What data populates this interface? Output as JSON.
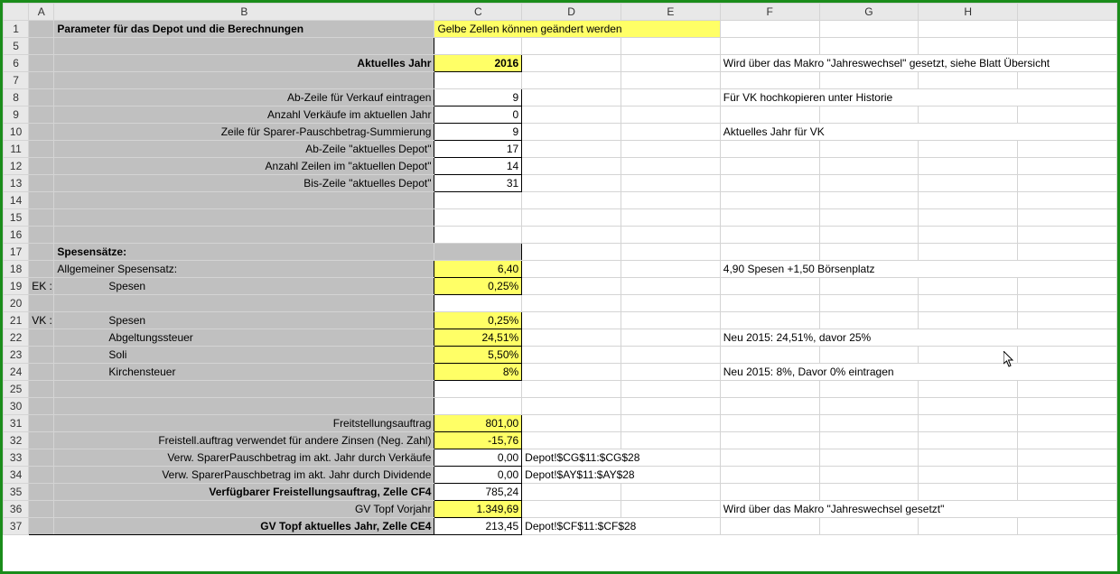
{
  "columns": [
    "A",
    "B",
    "C",
    "D",
    "E",
    "F",
    "G",
    "H"
  ],
  "r1": {
    "B": "Parameter für das Depot und die Berechnungen",
    "C": "Gelbe Zellen können geändert werden"
  },
  "r6": {
    "B": "Aktuelles Jahr",
    "C": "2016",
    "F": "Wird über das Makro \"Jahreswechsel\" gesetzt, siehe Blatt Übersicht"
  },
  "r8": {
    "B": "Ab-Zeile für Verkauf eintragen",
    "C": "9",
    "F": "Für VK hochkopieren unter Historie"
  },
  "r9": {
    "B": "Anzahl Verkäufe im aktuellen Jahr",
    "C": "0"
  },
  "r10": {
    "B": "Zeile für Sparer-Pauschbetrag-Summierung",
    "C": "9",
    "F": "Aktuelles Jahr für VK"
  },
  "r11": {
    "B": "Ab-Zeile \"aktuelles Depot\"",
    "C": "17"
  },
  "r12": {
    "B": "Anzahl Zeilen im \"aktuellen Depot\"",
    "C": "14"
  },
  "r13": {
    "B": "Bis-Zeile \"aktuelles Depot\"",
    "C": "31"
  },
  "r17": {
    "B": "Spesensätze:"
  },
  "r18": {
    "B": "Allgemeiner Spesensatz:",
    "C": "6,40",
    "F": "4,90 Spesen +1,50 Börsenplatz"
  },
  "r19": {
    "A": "EK :",
    "B": "Spesen",
    "C": "0,25%"
  },
  "r21": {
    "A": "VK :",
    "B": "Spesen",
    "C": "0,25%"
  },
  "r22": {
    "B": "Abgeltungssteuer",
    "C": "24,51%",
    "F": "Neu 2015: 24,51%, davor 25%"
  },
  "r23": {
    "B": "Soli",
    "C": "5,50%"
  },
  "r24": {
    "B": "Kirchensteuer",
    "C": "8%",
    "F": "Neu 2015: 8%, Davor 0% eintragen"
  },
  "r31": {
    "B": "Freitstellungsauftrag",
    "C": "801,00"
  },
  "r32": {
    "B": "Freistell.auftrag verwendet für andere Zinsen (Neg. Zahl)",
    "C": "-15,76"
  },
  "r33": {
    "B": "Verw. SparerPauschbetrag im akt. Jahr durch Verkäufe",
    "C": "0,00",
    "D": "Depot!$CG$11:$CG$28"
  },
  "r34": {
    "B": "Verw. SparerPauschbetrag im akt. Jahr durch Dividende",
    "C": "0,00",
    "D": "Depot!$AY$11:$AY$28"
  },
  "r35": {
    "B": "Verfügbarer Freistellungsauftrag, Zelle CF4",
    "C": "785,24"
  },
  "r36": {
    "B": "GV Topf Vorjahr",
    "C": "1.349,69",
    "F": "Wird über das Makro \"Jahreswechsel gesetzt\""
  },
  "r37": {
    "B": "GV Topf aktuelles Jahr, Zelle CE4",
    "C": "213,45",
    "D": "Depot!$CF$11:$CF$28"
  }
}
